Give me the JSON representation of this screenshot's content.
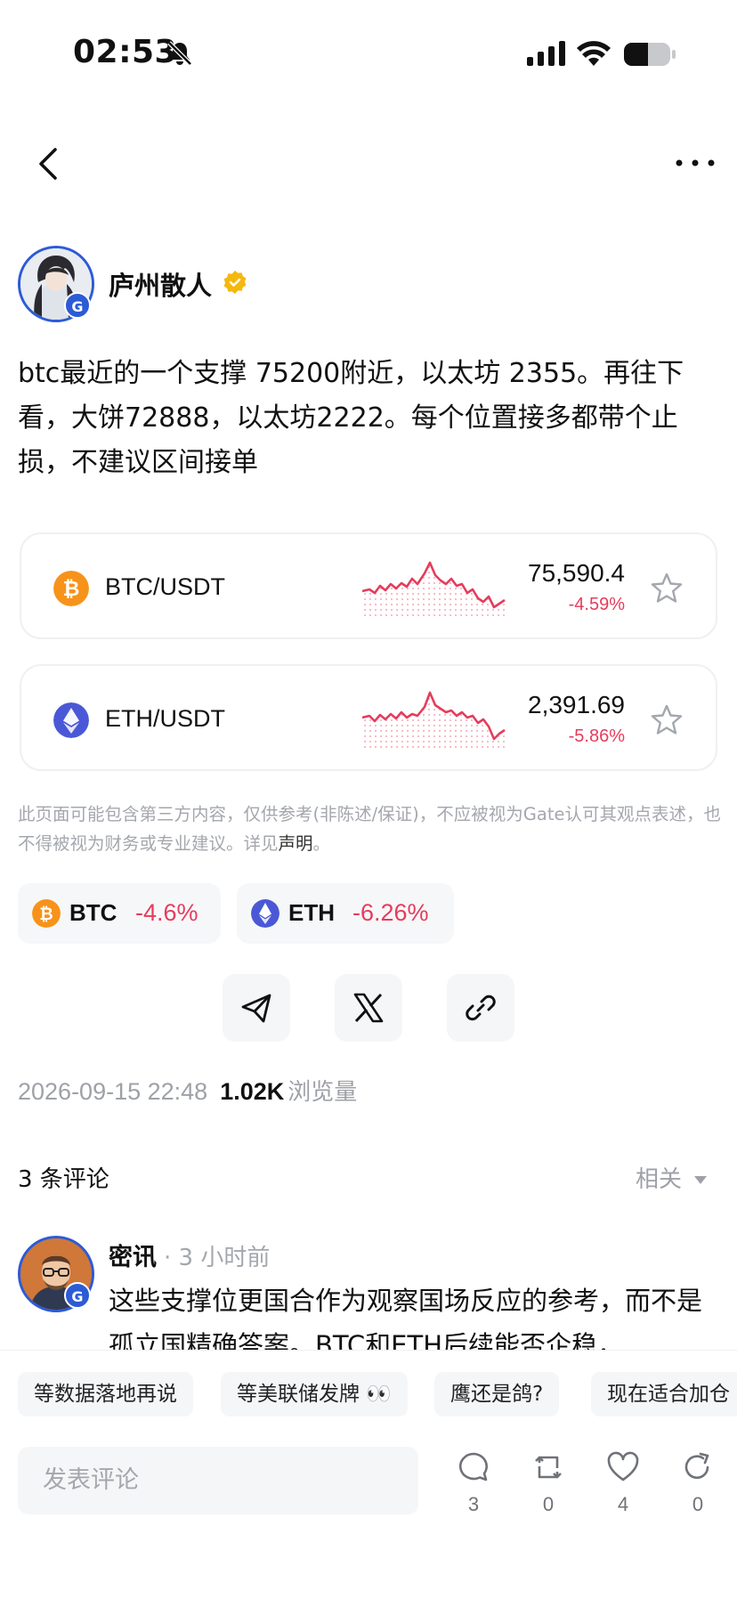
{
  "status_bar": {
    "time": "02:53"
  },
  "author": {
    "name": "庐州散人"
  },
  "post": {
    "text": "btc最近的一个支撑 75200附近，以太坊 2355。再往下看，大饼72888，以太坊2222。每个位置接多都带个止损，不建议区间接单"
  },
  "markets": [
    {
      "pair": "BTC/USDT",
      "price": "75,590.4",
      "change": "-4.59%",
      "icon_color": "#f7931a"
    },
    {
      "pair": "ETH/USDT",
      "price": "2,391.69",
      "change": "-5.86%",
      "icon_color": "#4a58d8"
    }
  ],
  "disclaimer": {
    "text": "此页面可能包含第三方内容，仅供参考(非陈述/保证)，不应被视为Gate认可其观点表述，也不得被视为财务或专业建议。详见",
    "link": "声明",
    "end": "。"
  },
  "tickers": [
    {
      "symbol": "BTC",
      "change": "-4.6%"
    },
    {
      "symbol": "ETH",
      "change": "-6.26%"
    }
  ],
  "meta": {
    "datetime": "2026-09-15 22:48",
    "views": "1.02K",
    "views_label": "浏览量"
  },
  "comments": {
    "title": "3 条评论",
    "sort": "相关",
    "first": {
      "author": "密讯",
      "time": "· 3 小时前",
      "text": "这些支撑位更国合作为观察国场反应的参考，而不是孤立国精确答案。BTC和ETH后续能否企稳，"
    }
  },
  "quick_replies": [
    "等数据落地再说",
    "等美联储发牌 👀",
    "鹰还是鸽?",
    "现在适合加仓"
  ],
  "comment_input": {
    "placeholder": "发表评论"
  },
  "actions": {
    "comments": "3",
    "reposts": "0",
    "likes": "4",
    "shares": "0"
  },
  "colors": {
    "accent_red": "#e63c5c",
    "brand_blue": "#2c5bd6"
  }
}
